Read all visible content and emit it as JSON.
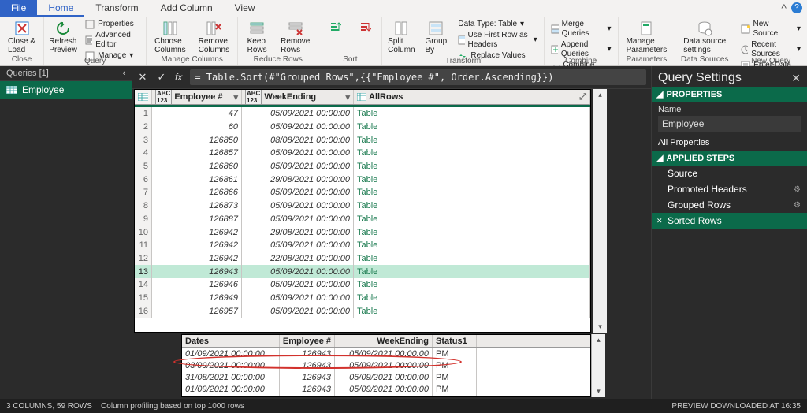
{
  "menu": {
    "file": "File",
    "home": "Home",
    "transform": "Transform",
    "add_column": "Add Column",
    "view": "View"
  },
  "ribbon": {
    "close_load": "Close &\nLoad",
    "close_group": "Close",
    "refresh": "Refresh\nPreview",
    "properties": "Properties",
    "advanced": "Advanced Editor",
    "manage": "Manage",
    "query_group": "Query",
    "choose_cols": "Choose\nColumns",
    "remove_cols": "Remove\nColumns",
    "manage_cols_group": "Manage Columns",
    "keep_rows": "Keep\nRows",
    "remove_rows": "Remove\nRows",
    "reduce_group": "Reduce Rows",
    "sort_group": "Sort",
    "split": "Split\nColumn",
    "group_by": "Group\nBy",
    "datatype": "Data Type: Table",
    "first_row": "Use First Row as Headers",
    "replace": "Replace Values",
    "transform_group": "Transform",
    "merge": "Merge Queries",
    "append": "Append Queries",
    "combine": "Combine Files",
    "combine_group": "Combine",
    "params": "Manage\nParameters",
    "params_group": "Parameters",
    "ds": "Data source\nsettings",
    "ds_group": "Data Sources",
    "new_src": "New Source",
    "recent": "Recent Sources",
    "enter": "Enter Data",
    "new_query_group": "New Query"
  },
  "queries_panel": {
    "title": "Queries [1]",
    "item": "Employee"
  },
  "formula_bar": {
    "formula": "= Table.Sort(#\"Grouped Rows\",{{\"Employee #\", Order.Ascending}})"
  },
  "grid_headers": {
    "emp": "Employee #",
    "wk": "WeekEnding",
    "all": "AllRows"
  },
  "rows": [
    {
      "n": "1",
      "emp": "47",
      "wk": "05/09/2021 00:00:00",
      "all": "Table"
    },
    {
      "n": "2",
      "emp": "60",
      "wk": "05/09/2021 00:00:00",
      "all": "Table"
    },
    {
      "n": "3",
      "emp": "126850",
      "wk": "08/08/2021 00:00:00",
      "all": "Table"
    },
    {
      "n": "4",
      "emp": "126857",
      "wk": "05/09/2021 00:00:00",
      "all": "Table"
    },
    {
      "n": "5",
      "emp": "126860",
      "wk": "05/09/2021 00:00:00",
      "all": "Table"
    },
    {
      "n": "6",
      "emp": "126861",
      "wk": "29/08/2021 00:00:00",
      "all": "Table"
    },
    {
      "n": "7",
      "emp": "126866",
      "wk": "05/09/2021 00:00:00",
      "all": "Table"
    },
    {
      "n": "8",
      "emp": "126873",
      "wk": "05/09/2021 00:00:00",
      "all": "Table"
    },
    {
      "n": "9",
      "emp": "126887",
      "wk": "05/09/2021 00:00:00",
      "all": "Table"
    },
    {
      "n": "10",
      "emp": "126942",
      "wk": "29/08/2021 00:00:00",
      "all": "Table"
    },
    {
      "n": "11",
      "emp": "126942",
      "wk": "05/09/2021 00:00:00",
      "all": "Table"
    },
    {
      "n": "12",
      "emp": "126942",
      "wk": "22/08/2021 00:00:00",
      "all": "Table"
    },
    {
      "n": "13",
      "emp": "126943",
      "wk": "05/09/2021 00:00:00",
      "all": "Table"
    },
    {
      "n": "14",
      "emp": "126946",
      "wk": "05/09/2021 00:00:00",
      "all": "Table"
    },
    {
      "n": "15",
      "emp": "126949",
      "wk": "05/09/2021 00:00:00",
      "all": "Table"
    },
    {
      "n": "16",
      "emp": "126957",
      "wk": "05/09/2021 00:00:00",
      "all": "Table"
    }
  ],
  "detail_headers": {
    "dates": "Dates",
    "emp": "Employee #",
    "wk": "WeekEnding",
    "st": "Status1"
  },
  "detail_rows": [
    {
      "d": "01/09/2021 00:00:00",
      "e": "126943",
      "w": "05/09/2021 00:00:00",
      "s": "PM"
    },
    {
      "d": "03/09/2021 00:00:00",
      "e": "126943",
      "w": "05/09/2021 00:00:00",
      "s": "PM"
    },
    {
      "d": "31/08/2021 00:00:00",
      "e": "126943",
      "w": "05/09/2021 00:00:00",
      "s": "PM"
    },
    {
      "d": "01/09/2021 00:00:00",
      "e": "126943",
      "w": "05/09/2021 00:00:00",
      "s": "PM"
    }
  ],
  "query_settings": {
    "title": "Query Settings",
    "properties": "PROPERTIES",
    "name_label": "Name",
    "name_value": "Employee",
    "all_props": "All Properties",
    "applied": "APPLIED STEPS",
    "steps": [
      "Source",
      "Promoted Headers",
      "Grouped Rows",
      "Sorted Rows"
    ]
  },
  "status": {
    "left": "3 COLUMNS, 59 ROWS",
    "mid": "Column profiling based on top 1000 rows",
    "right": "PREVIEW DOWNLOADED AT 16:35"
  }
}
